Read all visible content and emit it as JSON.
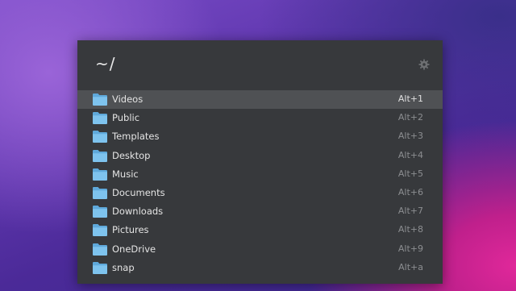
{
  "search": {
    "query": "~/"
  },
  "icons": {
    "settings": "gear-icon",
    "folder": "folder-icon"
  },
  "colors": {
    "panel": "#37393c",
    "selected_row": "#4f5154",
    "folder": "#7ec3ee"
  },
  "results": [
    {
      "name": "Videos",
      "shortcut": "Alt+1",
      "selected": true
    },
    {
      "name": "Public",
      "shortcut": "Alt+2"
    },
    {
      "name": "Templates",
      "shortcut": "Alt+3"
    },
    {
      "name": "Desktop",
      "shortcut": "Alt+4"
    },
    {
      "name": "Music",
      "shortcut": "Alt+5"
    },
    {
      "name": "Documents",
      "shortcut": "Alt+6"
    },
    {
      "name": "Downloads",
      "shortcut": "Alt+7"
    },
    {
      "name": "Pictures",
      "shortcut": "Alt+8"
    },
    {
      "name": "OneDrive",
      "shortcut": "Alt+9"
    },
    {
      "name": "snap",
      "shortcut": "Alt+a"
    }
  ]
}
